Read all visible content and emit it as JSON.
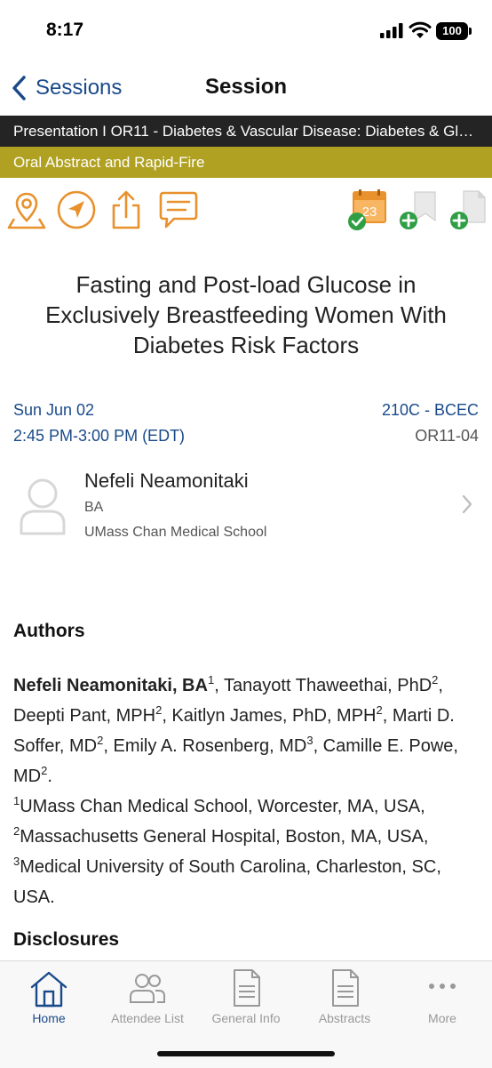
{
  "status": {
    "time": "8:17",
    "battery": "100"
  },
  "nav": {
    "back_label": "Sessions",
    "title": "Session"
  },
  "banner": {
    "type_text": "Presentation I OR11 - Diabetes & Vascular Disease: Diabetes & Gl…",
    "type_color": "#242424",
    "format_text": "Oral Abstract and Rapid-Fire",
    "format_color": "#b0a122"
  },
  "actions": {
    "left": [
      "map-pin-icon",
      "navigate-icon",
      "share-icon",
      "comment-icon"
    ],
    "right": [
      "calendar-added-icon",
      "bookmark-add-icon",
      "note-add-icon"
    ],
    "calendar_day": "23",
    "accent_color": "#e8912d",
    "check_color": "#2f9e44"
  },
  "session": {
    "title": "Fasting and Post-load Glucose in Exclusively Breastfeeding Women With Diabetes Risk Factors",
    "date": "Sun Jun 02",
    "time": "2:45 PM-3:00 PM (EDT)",
    "room": "210C - BCEC",
    "code": "OR11-04"
  },
  "presenter": {
    "name": "Nefeli Neamonitaki",
    "degree": "BA",
    "institution": "UMass Chan Medical School"
  },
  "authors": {
    "heading": "Authors",
    "lead_author": "Nefeli Neamonitaki, BA",
    "lead_sup": "1",
    "t1": ", Tanayott Thaweethai, PhD",
    "s1": "2",
    "t2": ", Deepti Pant, MPH",
    "s2": "2",
    "t3": ", Kaitlyn James, PhD, MPH",
    "s3": "2",
    "t4": ", Marti D. Soffer, MD",
    "s4": "2",
    "t5": ", Emily A. Rosenberg, MD",
    "s5": "3",
    "t6": ", Camille E. Powe, MD",
    "s6": "2",
    "t7": ".",
    "aff1_sup": "1",
    "aff1": "UMass Chan Medical School, Worcester, MA, USA,",
    "aff2_sup": "2",
    "aff2": "Massachusetts General Hospital, Boston, MA, USA,",
    "aff3_sup": "3",
    "aff3": "Medical University of South Carolina, Charleston, SC, USA."
  },
  "disclosures": {
    "heading": "Disclosures"
  },
  "tabs": [
    {
      "label": "Home",
      "icon": "home-icon",
      "active": true
    },
    {
      "label": "Attendee List",
      "icon": "people-icon",
      "active": false
    },
    {
      "label": "General Info",
      "icon": "document-icon",
      "active": false
    },
    {
      "label": "Abstracts",
      "icon": "document-icon",
      "active": false
    },
    {
      "label": "More",
      "icon": "more-icon",
      "active": false
    }
  ],
  "colors": {
    "brand_blue": "#1a4a8a",
    "tab_inactive": "#999999"
  }
}
